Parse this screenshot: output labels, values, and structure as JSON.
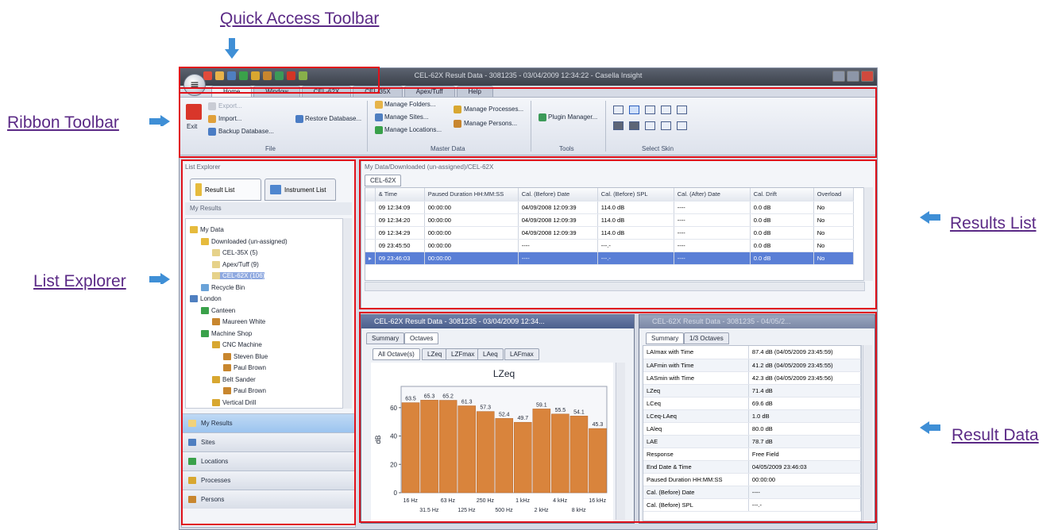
{
  "callouts": {
    "quick_access": "Quick Access Toolbar",
    "ribbon": "Ribbon Toolbar",
    "list_explorer": "List Explorer",
    "results_list": "Results List",
    "result_data": "Result Data"
  },
  "window": {
    "title": "CEL-62X Result Data - 3081235 - 03/04/2009 12:34:22 - Casella Insight",
    "orb_icon": "app-menu-icon"
  },
  "tabs": [
    "Home",
    "Window",
    "CEL-62X",
    "CEL-35X",
    "Apex/Tuff",
    "Help"
  ],
  "ribbon": {
    "exit": "Exit",
    "export": "Export...",
    "import": "Import...",
    "backup": "Backup Database...",
    "restore": "Restore Database...",
    "file_group": "File",
    "manage_folders": "Manage Folders...",
    "manage_sites": "Manage Sites...",
    "manage_locations": "Manage Locations...",
    "manage_processes": "Manage Processes...",
    "manage_persons": "Manage Persons...",
    "master_group": "Master Data",
    "plugin_manager": "Plugin Manager...",
    "tools_group": "Tools",
    "skin_group": "Select Skin"
  },
  "list_explorer": {
    "title": "List Explorer",
    "tab_result": "Result List",
    "tab_instrument": "Instrument List",
    "section": "My Results",
    "tree": [
      {
        "label": "My Data",
        "depth": 0
      },
      {
        "label": "Downloaded (un-assigned)",
        "depth": 1
      },
      {
        "label": "CEL-35X (5)",
        "depth": 2
      },
      {
        "label": "Apex/Tuff (9)",
        "depth": 2
      },
      {
        "label": "CEL-62X (106)",
        "depth": 2
      },
      {
        "label": "Recycle Bin",
        "depth": 1
      },
      {
        "label": "London",
        "depth": 0
      },
      {
        "label": "Canteen",
        "depth": 1
      },
      {
        "label": "Maureen White",
        "depth": 2
      },
      {
        "label": "Machine Shop",
        "depth": 1
      },
      {
        "label": "CNC Machine",
        "depth": 2
      },
      {
        "label": "Steven Blue",
        "depth": 3
      },
      {
        "label": "Paul Brown",
        "depth": 3
      },
      {
        "label": "Belt Sander",
        "depth": 2
      },
      {
        "label": "Paul Brown",
        "depth": 3
      },
      {
        "label": "Vertical Drill",
        "depth": 2
      }
    ],
    "nav": [
      "My Results",
      "Sites",
      "Locations",
      "Processes",
      "Persons"
    ]
  },
  "results_list": {
    "path": "My Data/Downloaded (un-assigned)/CEL-62X",
    "tab": "CEL-62X",
    "columns": [
      "& Time",
      "Paused Duration HH:MM:SS",
      "Cal. (Before) Date",
      "Cal. (Before) SPL",
      "Cal. (After) Date",
      "Cal. Drift",
      "Overload"
    ],
    "rows": [
      [
        "09 12:34:09",
        "00:00:00",
        "04/09/2008 12:09:39",
        "114.0 dB",
        "----",
        "0.0 dB",
        "No"
      ],
      [
        "09 12:34:20",
        "00:00:00",
        "04/09/2008 12:09:39",
        "114.0 dB",
        "----",
        "0.0 dB",
        "No"
      ],
      [
        "09 12:34:29",
        "00:00:00",
        "04/09/2008 12:09:39",
        "114.0 dB",
        "----",
        "0.0 dB",
        "No"
      ],
      [
        "09 23:45:50",
        "00:00:00",
        "----",
        "---.-",
        "----",
        "0.0 dB",
        "No"
      ],
      [
        "09 23:46:03",
        "00:00:00",
        "----",
        "---.-",
        "----",
        "0.0 dB",
        "No"
      ]
    ]
  },
  "result_left": {
    "title": "CEL-62X Result Data - 3081235 - 03/04/2009 12:34...",
    "tabs": [
      "Summary",
      "Octaves"
    ],
    "subtabs": [
      "All Octave(s)",
      "LZeq",
      "LZFmax",
      "LAeq",
      "LAFmax"
    ]
  },
  "result_right": {
    "title": "CEL-62X Result Data - 3081235 - 04/05/2...",
    "tabs": [
      "Summary",
      "1/3 Octaves"
    ],
    "rows": [
      [
        "LAImax with Time",
        "87.4 dB (04/05/2009 23:45:59)"
      ],
      [
        "LAFmin with Time",
        "41.2 dB (04/05/2009 23:45:55)"
      ],
      [
        "LASmin with Time",
        "42.3 dB (04/05/2009 23:45:56)"
      ],
      [
        "LZeq",
        "71.4 dB"
      ],
      [
        "LCeq",
        "69.6 dB"
      ],
      [
        "LCeq-LAeq",
        "1.0 dB"
      ],
      [
        "LAleq",
        "80.0 dB"
      ],
      [
        "LAE",
        "78.7 dB"
      ],
      [
        "Response",
        "Free Field"
      ],
      [
        "End Date & Time",
        "04/05/2009 23:46:03"
      ],
      [
        "Paused Duration HH:MM:SS",
        "00:00:00"
      ],
      [
        "Cal. (Before) Date",
        "----"
      ],
      [
        "Cal. (Before) SPL",
        "---.-"
      ]
    ]
  },
  "chart_data": {
    "type": "bar",
    "title": "LZeq",
    "ylabel": "dB",
    "ylim": [
      0,
      75
    ],
    "yticks": [
      0,
      20,
      40,
      60
    ],
    "xticks_top": [
      "16 Hz",
      "63 Hz",
      "250 Hz",
      "1 kHz",
      "4 kHz",
      "16 kHz"
    ],
    "xticks_bottom": [
      "31.5 Hz",
      "125 Hz",
      "500 Hz",
      "2 kHz",
      "8 kHz"
    ],
    "values": [
      63.5,
      65.3,
      65.2,
      61.3,
      57.3,
      52.4,
      49.7,
      59.1,
      55.5,
      54.1,
      45.3
    ],
    "labels": [
      "63.5",
      "65.3",
      "65.2",
      "61.3",
      "57.3",
      "52.4",
      "49.7",
      "59.1",
      "55.5",
      "54.1",
      "45.3"
    ],
    "bar_color": "#d9843c"
  }
}
